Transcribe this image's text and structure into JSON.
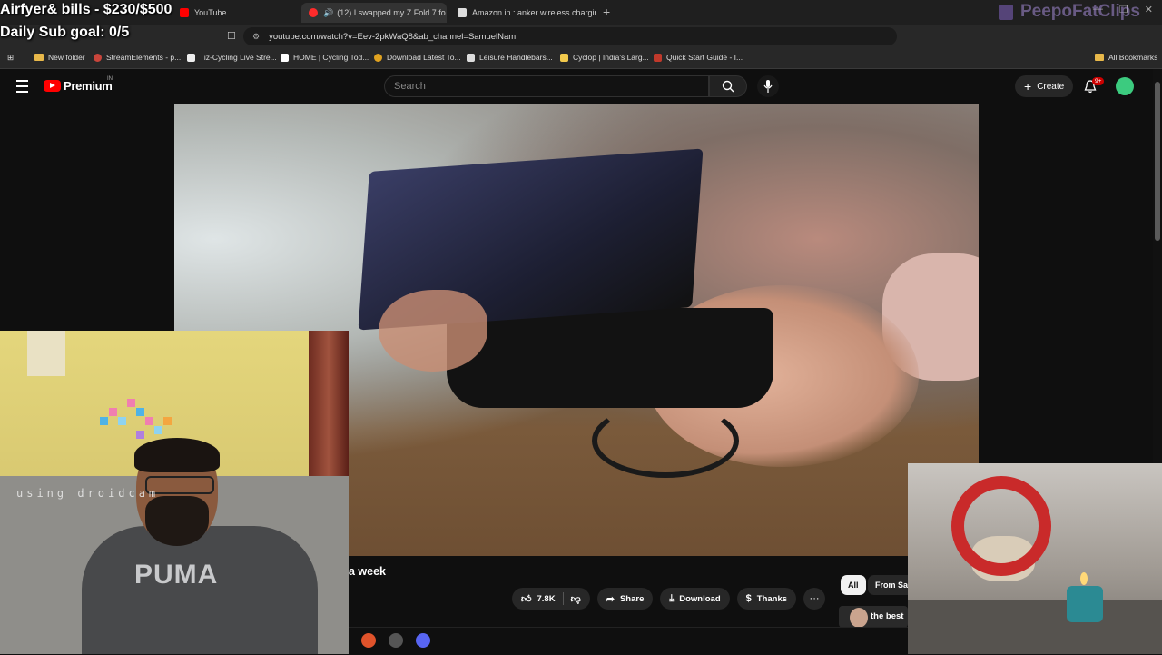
{
  "stream_overlay": {
    "goal_line": "Airfyer& bills - $230/$500",
    "sub_goal": "Daily Sub goal: 0/5",
    "channel_watermark": "PeepoFatClips"
  },
  "browser": {
    "tabs": [
      {
        "label": "YouTube",
        "active": false
      },
      {
        "label": "(12) I swapped my Z Fold 7 fo",
        "active": true
      },
      {
        "label": "Amazon.in : anker wireless charging",
        "active": false
      }
    ],
    "url": "youtube.com/watch?v=Eev-2pkWaQ8&ab_channel=SamuelNam",
    "bookmarks": [
      "New folder",
      "StreamElements - p...",
      "Tiz-Cycling Live Stre...",
      "HOME | Cycling Tod...",
      "Download Latest To...",
      "Leisure Handlebars...",
      "Cyclop | India's Larg...",
      "Quick Start Guide - I..."
    ],
    "all_bookmarks": "All Bookmarks",
    "colors": {
      "chrome": "#1f1f1f",
      "accent_red": "#ff0000"
    }
  },
  "youtube": {
    "logo_text": "Premium",
    "region": "IN",
    "search_placeholder": "Search",
    "create_label": "Create",
    "notifications_badge": "9+",
    "video_title_fragment": "a week",
    "like_count": "7.8K",
    "share_label": "Share",
    "download_label": "Download",
    "thanks_label": "Thanks",
    "chips": [
      "All",
      "From Sa"
    ],
    "recommended_fragment": "the best"
  },
  "webcam": {
    "watermark": "using droidcam",
    "shirt_text": "PUMA"
  }
}
